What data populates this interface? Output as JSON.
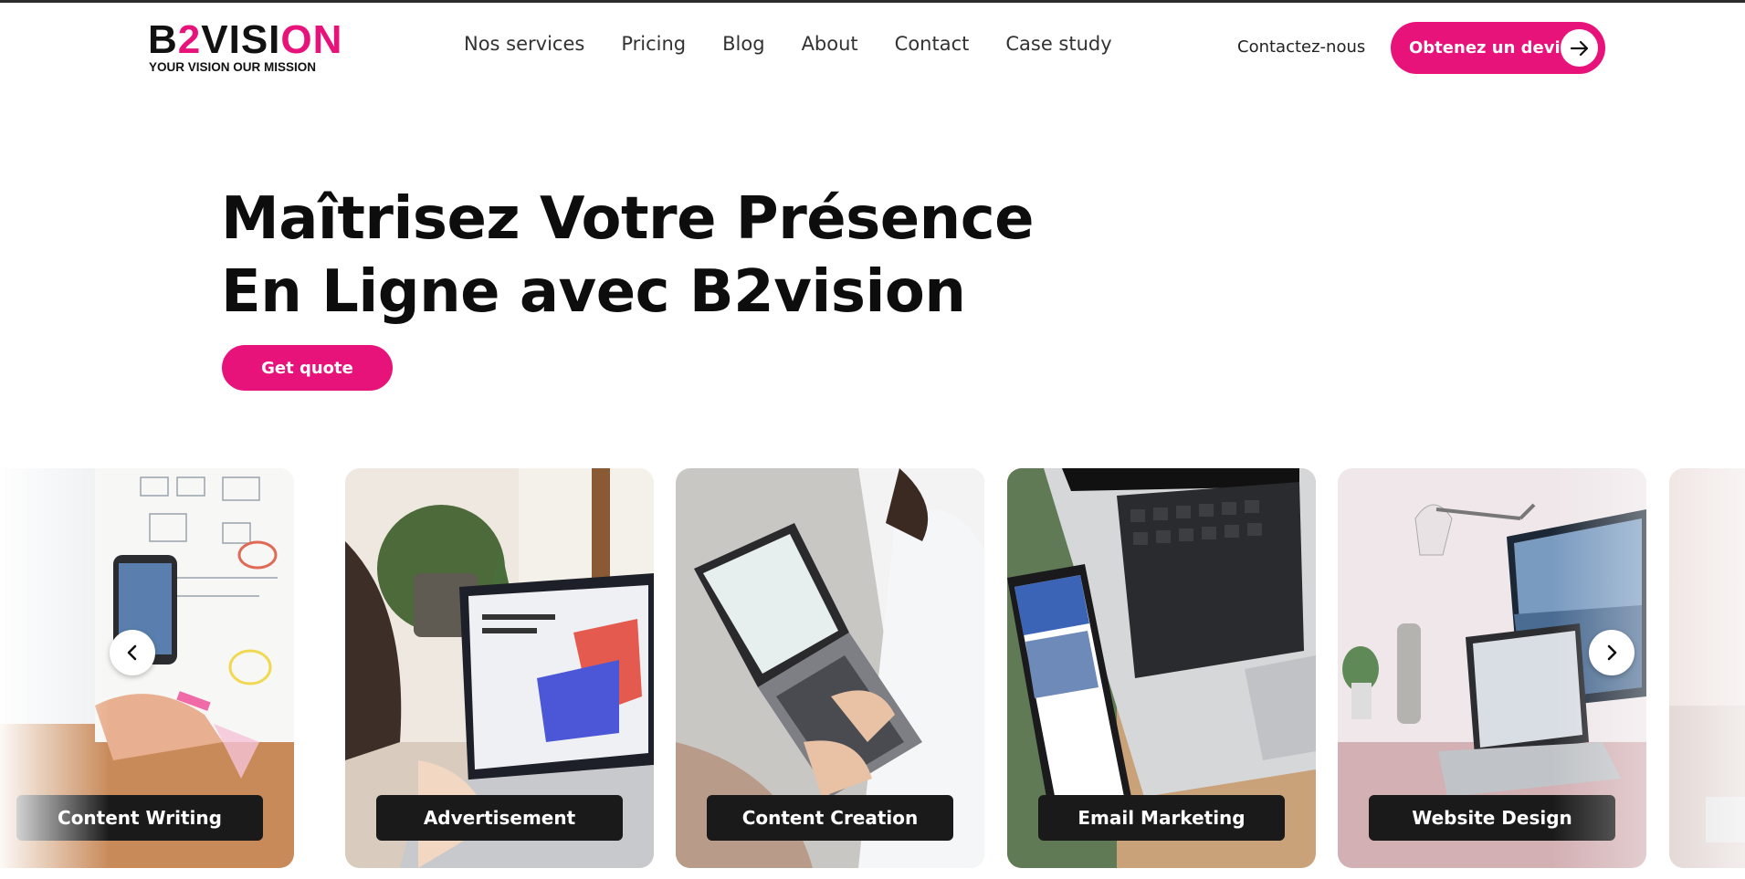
{
  "brand": {
    "name_prefix": "B",
    "name_mid": "2",
    "name_suffix": "VISI",
    "name_end": "ON",
    "tagline": "YOUR VISION OUR MISSION",
    "accent": "#e8137a"
  },
  "nav": {
    "items": [
      "Nos services",
      "Pricing",
      "Blog",
      "About",
      "Contact",
      "Case study"
    ]
  },
  "header": {
    "contact_label": "Contactez-nous",
    "quote_label": "Obtenez un devis",
    "quote_icon": "arrow-right-icon"
  },
  "hero": {
    "title": "Maîtrisez Votre Présence En Ligne avec B2vision",
    "cta_label": "Get quote"
  },
  "carousel": {
    "cards": [
      {
        "label": "Content Writing"
      },
      {
        "label": "Advertisement"
      },
      {
        "label": "Content Creation"
      },
      {
        "label": "Email Marketing"
      },
      {
        "label": "Website Design"
      }
    ],
    "prev_icon": "chevron-left-icon",
    "next_icon": "chevron-right-icon"
  }
}
